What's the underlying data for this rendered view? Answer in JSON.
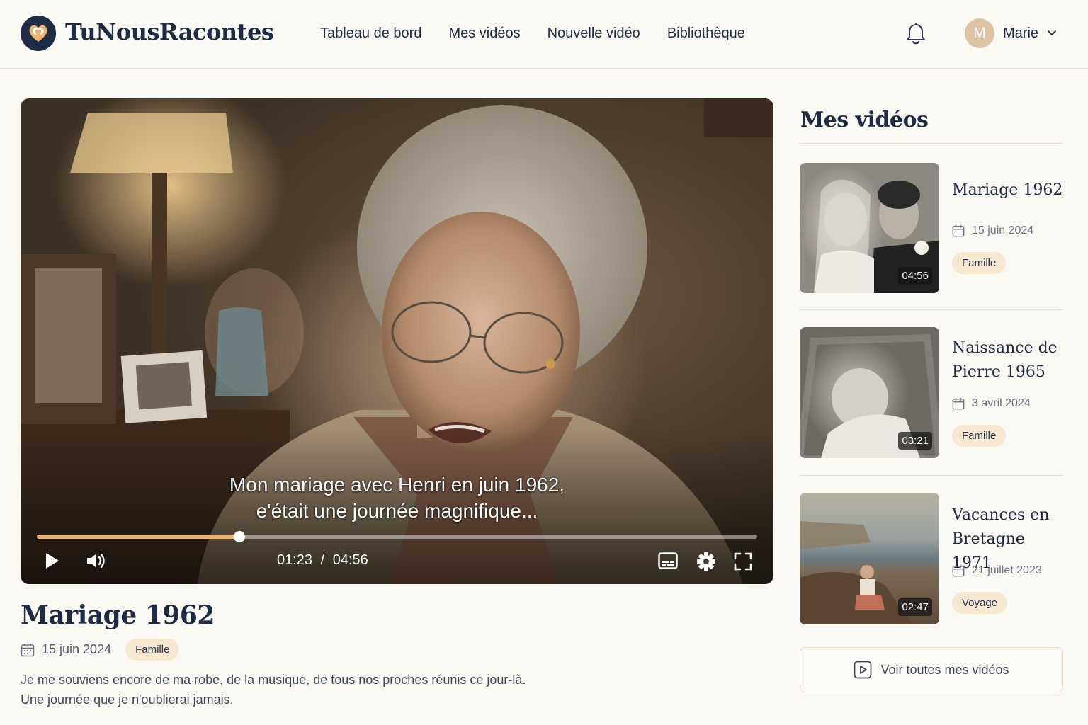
{
  "app": {
    "name": "TuNousRacontes"
  },
  "nav": {
    "items": [
      "Tableau de bord",
      "Mes vidéos",
      "Nouvelle vidéo",
      "Bibliothèque"
    ]
  },
  "user": {
    "initial": "M",
    "name": "Marie"
  },
  "player": {
    "subtitle_line1": "Mon mariage avec Henri en juin 1962,",
    "subtitle_line2": "e'était une journée magnifique...",
    "current_time": "01:23",
    "separator": "/",
    "duration": "04:56",
    "progress_fraction": 0.281
  },
  "video": {
    "title": "Mariage 1962",
    "date": "15 juin 2024",
    "tag": "Famille",
    "description_line1": "Je me souviens encore de ma robe, de la musique, de tous nos proches réunis ce jour-là.",
    "description_line2": "Une journée que je n'oublierai jamais."
  },
  "sidebar": {
    "title": "Mes vidéos",
    "videos": [
      {
        "title": "Mariage 1962",
        "date": "15 juin 2024",
        "tag": "Famille",
        "duration": "04:56"
      },
      {
        "title": "Naissance de Pierre 1965",
        "date": "3 avril 2024",
        "tag": "Famille",
        "duration": "03:21"
      },
      {
        "title": "Vacances en Bretagne 1971",
        "date": "21 juillet 2023",
        "tag": "Voyage",
        "duration": "02:47"
      }
    ],
    "see_all_label": "Voir toutes mes vidéos"
  },
  "colors": {
    "accent": "#e8b46f",
    "navy": "#1f2a44",
    "tag_bg": "#f7e8d2",
    "page_bg": "#fbf9f4"
  }
}
